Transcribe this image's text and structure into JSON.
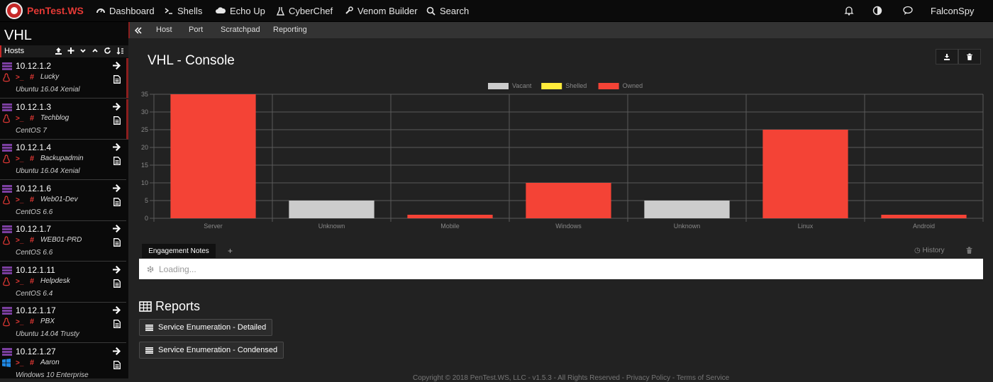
{
  "brand": {
    "name": "PenTest.WS"
  },
  "nav": {
    "dashboard": "Dashboard",
    "shells": "Shells",
    "echo_up": "Echo Up",
    "cyberchef": "CyberChef",
    "venom_builder": "Venom Builder",
    "search": "Search",
    "user": "FalconSpy"
  },
  "sidebar": {
    "project": "VHL",
    "hosts_label": "Hosts",
    "hosts": [
      {
        "ip": "10.12.1.2",
        "name": "Lucky",
        "os": "Ubuntu 16.04 Xenial",
        "os_icon": "linux-icon"
      },
      {
        "ip": "10.12.1.3",
        "name": "Techblog",
        "os": "CentOS 7",
        "os_icon": "linux-icon"
      },
      {
        "ip": "10.12.1.4",
        "name": "Backupadmin",
        "os": "Ubuntu 16.04 Xenial",
        "os_icon": "linux-icon"
      },
      {
        "ip": "10.12.1.6",
        "name": "Web01-Dev",
        "os": "CentOS 6.6",
        "os_icon": "linux-icon"
      },
      {
        "ip": "10.12.1.7",
        "name": "WEB01-PRD",
        "os": "CentOS 6.6",
        "os_icon": "linux-icon"
      },
      {
        "ip": "10.12.1.11",
        "name": "Helpdesk",
        "os": "CentOS 6.4",
        "os_icon": "linux-icon"
      },
      {
        "ip": "10.12.1.17",
        "name": "PBX",
        "os": "Ubuntu 14.04 Trusty",
        "os_icon": "linux-icon"
      },
      {
        "ip": "10.12.1.27",
        "name": "Aaron",
        "os": "Windows 10 Enterprise",
        "os_icon": "windows-icon"
      }
    ]
  },
  "tabs": {
    "host": "Host",
    "port": "Port",
    "scratchpad": "Scratchpad",
    "reporting": "Reporting"
  },
  "page": {
    "title": "VHL - Console"
  },
  "chart_data": {
    "type": "bar",
    "categories": [
      "Server",
      "Unknown",
      "Mobile",
      "Windows",
      "Unknown",
      "Linux",
      "Android"
    ],
    "series": [
      {
        "name": "Vacant",
        "color": "#cccccc",
        "values": [
          0,
          5,
          0,
          0,
          5,
          0,
          0
        ]
      },
      {
        "name": "Shelled",
        "color": "#ffeb3b",
        "values": [
          0,
          0,
          0,
          0,
          0,
          0,
          0
        ]
      },
      {
        "name": "Owned",
        "color": "#f44336",
        "values": [
          35,
          0,
          1,
          10,
          0,
          25,
          1
        ]
      }
    ],
    "ylim": [
      0,
      35
    ],
    "yticks": [
      0,
      5,
      10,
      15,
      20,
      25,
      30,
      35
    ],
    "grid": true,
    "stacked": true,
    "legend": "top-center"
  },
  "notes": {
    "tab_label": "Engagement Notes",
    "add": "+",
    "history": "History",
    "placeholder": "Loading..."
  },
  "reports": {
    "title": "Reports",
    "buttons": [
      "Service Enumeration - Detailed",
      "Service Enumeration - Condensed"
    ]
  },
  "footer": {
    "text": "Copyright © 2018 PenTest.WS, LLC - v1.5.3 - All Rights Reserved - Privacy Policy - Terms of Service"
  },
  "colors": {
    "accent": "#e53935",
    "server_icon": "#7b3fa0",
    "windows": "#1e88e5"
  }
}
